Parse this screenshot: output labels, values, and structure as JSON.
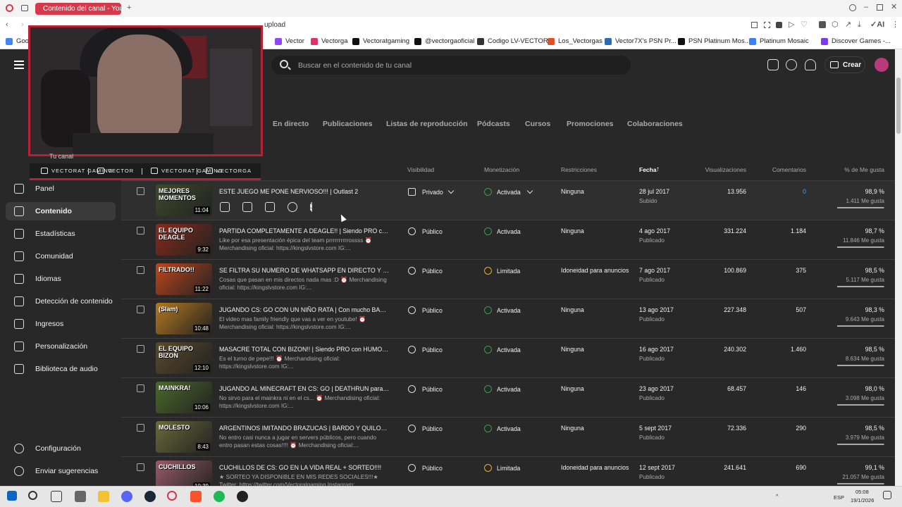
{
  "browser": {
    "tab_title": "Contenido del canal - YouTube",
    "url_text": "upload",
    "bookmarks": [
      {
        "label": "Google",
        "color": "#4285f4"
      },
      {
        "label": "Vector",
        "color": "#9146ff"
      },
      {
        "label": "Vectorga",
        "color": "#e1306c"
      },
      {
        "label": "Vectoratgaming",
        "color": "#111111"
      },
      {
        "label": "@vectorgaoficial",
        "color": "#111111"
      },
      {
        "label": "Codigo LV-VECTOR",
        "color": "#333333"
      },
      {
        "label": "Los_Vectorgas",
        "color": "#e34f26"
      },
      {
        "label": "Vector7X's PSN Pr...",
        "color": "#2b6cb0"
      },
      {
        "label": "PSN Platinum Mos...",
        "color": "#111111"
      },
      {
        "label": "Platinum Mosaic",
        "color": "#3b82f6"
      },
      {
        "label": "Discover Games -...",
        "color": "#7c3aed"
      }
    ]
  },
  "overlay": {
    "socials": [
      "VECTORAT GAMING",
      "VECTOR",
      "VECTORAT GAMING",
      "VECTORGA"
    ],
    "channel_label": "Tu canal"
  },
  "header": {
    "search_placeholder": "Buscar en el contenido de tu canal",
    "create_label": "Crear"
  },
  "tabs": [
    "En directo",
    "Publicaciones",
    "Listas de reproducción",
    "Pódcasts",
    "Cursos",
    "Promociones",
    "Colaboraciones"
  ],
  "sidebar": {
    "items": [
      {
        "label": "Panel",
        "icon": "dashboard-icon"
      },
      {
        "label": "Contenido",
        "icon": "content-icon",
        "active": true
      },
      {
        "label": "Estadísticas",
        "icon": "analytics-icon"
      },
      {
        "label": "Comunidad",
        "icon": "community-icon"
      },
      {
        "label": "Idiomas",
        "icon": "subtitles-icon"
      },
      {
        "label": "Detección de contenido",
        "icon": "copyright-icon"
      },
      {
        "label": "Ingresos",
        "icon": "dollar-icon"
      },
      {
        "label": "Personalización",
        "icon": "magic-wand-icon"
      },
      {
        "label": "Biblioteca de audio",
        "icon": "audio-library-icon"
      }
    ],
    "bottom": [
      {
        "label": "Configuración",
        "icon": "gear-icon"
      },
      {
        "label": "Enviar sugerencias",
        "icon": "feedback-icon"
      }
    ]
  },
  "table": {
    "columns": [
      "Visibilidad",
      "Monetización",
      "Restricciones",
      "Fecha",
      "Visualizaciones",
      "Comentarios",
      "% de Me gusta"
    ],
    "sort_column": "Fecha",
    "rows": [
      {
        "title": "ESTE JUEGO ME PONE NERVIOSO!!! | Outlast 2",
        "desc": "",
        "duration": "11:04",
        "thumb_text": "MEJORES MOMENTOS",
        "thumb_color": "#3d4a2a",
        "visibility": "Privado",
        "monetization": "Activada",
        "mon_color": "#2ba640",
        "restrictions": "Ninguna",
        "date": "28 jul 2017",
        "status": "Subido",
        "views": "13.956",
        "comments": "0",
        "likes_pct": "98,9 %",
        "likes_count": "1.411 Me gusta",
        "likes_fraction": 0.989
      },
      {
        "title": "PARTIDA COMPLETAMENTE A DEAGLE!! | Siendo PRO con H...",
        "desc": "Like por esa presentación épica del team prrrrrrrrrrossss ⏰ Merchandising oficial: https://kingslvstore.com IG:...",
        "duration": "9:32",
        "thumb_text": "EL EQUIPO DEAGLE",
        "thumb_color": "#8a2a1a",
        "visibility": "Público",
        "monetization": "Activada",
        "mon_color": "#2ba640",
        "restrictions": "Ninguna",
        "date": "4 ago 2017",
        "status": "Publicado",
        "views": "331.224",
        "comments": "1.184",
        "likes_pct": "98,7 %",
        "likes_count": "11.846 Me gusta",
        "likes_fraction": 0.987
      },
      {
        "title": "SE FILTRA SU NUMERO DE WHATSAPP EN DIRECTO Y PASA ...",
        "desc": "Cosas que pasan en mis directos nada mas :D ⏰ Merchandising oficial: https://kingslvstore.com IG:...",
        "duration": "11:22",
        "thumb_text": "FILTRADO!!",
        "thumb_color": "#c0451a",
        "visibility": "Público",
        "monetization": "Limitada",
        "mon_color": "#f9ab00",
        "restrictions": "Idoneidad para anuncios",
        "date": "7 ago 2017",
        "status": "Publicado",
        "views": "100.869",
        "comments": "375",
        "likes_pct": "98,5 %",
        "likes_count": "5.117 Me gusta",
        "likes_fraction": 0.985
      },
      {
        "title": "JUGANDO CS: GO CON UN NIÑO RATA | Con mucho BARDO ...",
        "desc": "El video mas family friendly que vas a ver en youtube! ⏰ Merchandising oficial: https://kingslvstore.com IG:...",
        "duration": "10:48",
        "thumb_text": "(Slam)",
        "thumb_color": "#b5781e",
        "visibility": "Público",
        "monetization": "Activada",
        "mon_color": "#2ba640",
        "restrictions": "Ninguna",
        "date": "13 ago 2017",
        "status": "Publicado",
        "views": "227.348",
        "comments": "507",
        "likes_pct": "98,3 %",
        "likes_count": "9.643 Me gusta",
        "likes_fraction": 0.983
      },
      {
        "title": "MASACRE TOTAL CON BIZON!! | Siendo PRO con HUMOR en...",
        "desc": "Es el turno de pepe!!! ⏰ Merchandising oficial: https://kingslvstore.com IG:...",
        "duration": "12:10",
        "thumb_text": "EL EQUIPO BIZON",
        "thumb_color": "#5a4a2a",
        "visibility": "Público",
        "monetization": "Activada",
        "mon_color": "#2ba640",
        "restrictions": "Ninguna",
        "date": "16 ago 2017",
        "status": "Publicado",
        "views": "240.302",
        "comments": "1.460",
        "likes_pct": "98,5 %",
        "likes_count": "8.634 Me gusta",
        "likes_fraction": 0.985
      },
      {
        "title": "JUGANDO AL MINECRAFT EN CS: GO | DEATHRUN para niño...",
        "desc": "No sirvo para el mainkra ni en el cs... ⏰ Merchandising oficial: https://kingslvstore.com IG:...",
        "duration": "10:06",
        "thumb_text": "MAINKRA!",
        "thumb_color": "#4a6a2a",
        "visibility": "Público",
        "monetization": "Activada",
        "mon_color": "#2ba640",
        "restrictions": "Ninguna",
        "date": "23 ago 2017",
        "status": "Publicado",
        "views": "68.457",
        "comments": "146",
        "likes_pct": "98,0 %",
        "likes_count": "3.098 Me gusta",
        "likes_fraction": 0.98
      },
      {
        "title": "ARGENTINOS IMITANDO BRAZUCAS | BARDO Y QUILOMBO ...",
        "desc": "No entro casi nunca a jugar en servers públicos, pero cuando entro pasan estas cosas!!!! ⏰ Merchandising oficial:...",
        "duration": "8:43",
        "thumb_text": "MOLESTO",
        "thumb_color": "#6a6a3a",
        "visibility": "Público",
        "monetization": "Activada",
        "mon_color": "#2ba640",
        "restrictions": "Ninguna",
        "date": "5 sept 2017",
        "status": "Publicado",
        "views": "72.336",
        "comments": "290",
        "likes_pct": "98,5 %",
        "likes_count": "3.979 Me gusta",
        "likes_fraction": 0.985
      },
      {
        "title": "CUCHILLOS DE CS: GO EN LA VIDA REAL + SORTEO!!!!",
        "desc": "★ SORTEO YA DISPONIBLE EN MIS REDES SOCIALES!!!★ Twitter: https://twitter.com/Vectoratgaming Instagram:...",
        "duration": "10:39",
        "thumb_text": "CUCHILLOS",
        "thumb_color": "#9a5a6a",
        "visibility": "Público",
        "monetization": "Limitada",
        "mon_color": "#f9ab00",
        "restrictions": "Idoneidad para anuncios",
        "date": "12 sept 2017",
        "status": "Publicado",
        "views": "241.641",
        "comments": "690",
        "likes_pct": "99,1 %",
        "likes_count": "21.057 Me gusta",
        "likes_fraction": 0.991
      }
    ]
  },
  "taskbar": {
    "lang": "ESP",
    "time": "05:08",
    "date": "19/1/2026"
  }
}
